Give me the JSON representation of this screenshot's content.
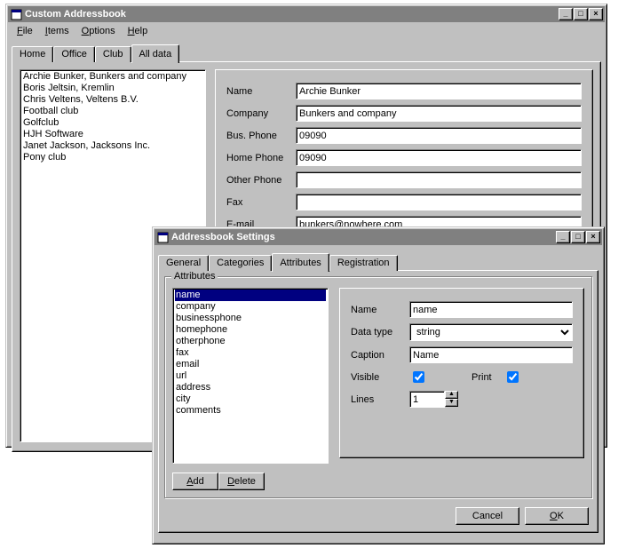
{
  "mainWindow": {
    "title": "Custom Addressbook",
    "menu": {
      "file": "File",
      "items": "Items",
      "options": "Options",
      "help": "Help"
    },
    "tabs": {
      "home": "Home",
      "office": "Office",
      "club": "Club",
      "alldata": "All data"
    },
    "contacts": [
      "Archie Bunker, Bunkers and company",
      "Boris Jeltsin, Kremlin",
      "Chris Veltens, Veltens B.V.",
      "Football club",
      "Golfclub",
      "HJH Software",
      "Janet Jackson, Jacksons Inc.",
      "Pony club"
    ],
    "form": {
      "nameLabel": "Name",
      "nameValue": "Archie Bunker",
      "companyLabel": "Company",
      "companyValue": "Bunkers and company",
      "busPhoneLabel": "Bus. Phone",
      "busPhoneValue": "09090",
      "homePhoneLabel": "Home Phone",
      "homePhoneValue": "09090",
      "otherPhoneLabel": "Other Phone",
      "otherPhoneValue": "",
      "faxLabel": "Fax",
      "faxValue": "",
      "emailLabel": "E-mail",
      "emailValue": "bunkers@nowhere.com"
    }
  },
  "settingsWindow": {
    "title": "Addressbook Settings",
    "tabs": {
      "general": "General",
      "categories": "Categories",
      "attributes": "Attributes",
      "registration": "Registration"
    },
    "groupLabel": "Attributes",
    "attrList": [
      "name",
      "company",
      "businessphone",
      "homephone",
      "otherphone",
      "fax",
      "email",
      "url",
      "address",
      "city",
      "comments"
    ],
    "selectedAttr": 0,
    "form": {
      "nameLabel": "Name",
      "nameValue": "name",
      "dataTypeLabel": "Data type",
      "dataTypeValue": "string",
      "captionLabel": "Caption",
      "captionValue": "Name",
      "visibleLabel": "Visible",
      "printLabel": "Print",
      "linesLabel": "Lines",
      "linesValue": "1"
    },
    "buttons": {
      "add": "Add",
      "delete": "Delete",
      "cancel": "Cancel",
      "ok": "OK"
    }
  }
}
